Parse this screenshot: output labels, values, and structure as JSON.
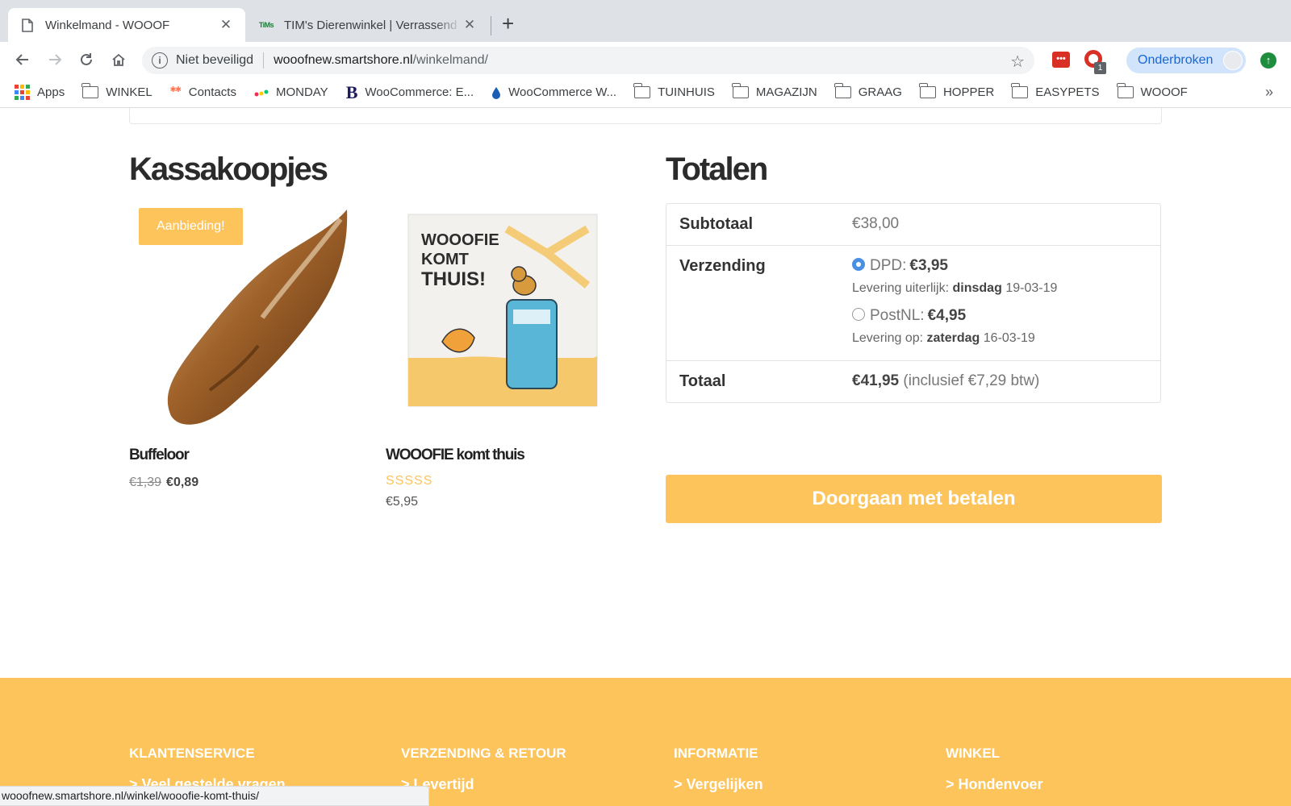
{
  "browser": {
    "tabs": [
      {
        "title": "Winkelmand - WOOOF",
        "active": true
      },
      {
        "title": "TIM's Dierenwinkel | Verrassend",
        "active": false,
        "favicon_text": "TiMs"
      }
    ],
    "omnibox": {
      "security": "Niet beveiligd",
      "host": "wooofnew.smartshore.nl",
      "path": "/winkelmand/"
    },
    "profile": "Onderbroken",
    "extension_badge": "1",
    "ext1_label": "•••",
    "bookmarks": [
      "Apps",
      "WINKEL",
      "Contacts",
      "MONDAY",
      "WooCommerce: E...",
      "WooCommerce W...",
      "TUINHUIS",
      "MAGAZIJN",
      "GRAAG",
      "HOPPER",
      "EASYPETS",
      "WOOOF"
    ],
    "status_url": "wooofnew.smartshore.nl/winkel/wooofie-komt-thuis/"
  },
  "cross_sells": {
    "heading": "Kassakoopjes",
    "products": [
      {
        "name": "Buffeloor",
        "sale_badge": "Aanbieding!",
        "old_price": "€1,39",
        "price": "€0,89"
      },
      {
        "name": "WOOOFIE komt thuis",
        "stars": "SSSSS",
        "price": "€5,95",
        "cover_text": "WOOOFIE KOMT THUIS!"
      }
    ]
  },
  "totals": {
    "heading": "Totalen",
    "subtotal_label": "Subtotaal",
    "subtotal_value": "€38,00",
    "shipping_label": "Verzending",
    "shipping_options": [
      {
        "carrier": "DPD:",
        "price": "€3,95",
        "note_prefix": "Levering uiterlijk:",
        "note_day": "dinsdag",
        "note_date": "19-03-19",
        "selected": true
      },
      {
        "carrier": "PostNL:",
        "price": "€4,95",
        "note_prefix": "Levering op:",
        "note_day": "zaterdag",
        "note_date": "16-03-19",
        "selected": false
      }
    ],
    "total_label": "Totaal",
    "total_value": "€41,95",
    "total_tax_note": "(inclusief €7,29 btw)"
  },
  "checkout_button": "Doorgaan met betalen",
  "footer": {
    "columns": [
      {
        "heading": "KLANTENSERVICE",
        "first_link": "> Veel gestelde vragen"
      },
      {
        "heading": "VERZENDING & RETOUR",
        "first_link": "> Levertijd"
      },
      {
        "heading": "INFORMATIE",
        "first_link": "> Vergelijken"
      },
      {
        "heading": "WINKEL",
        "first_link": "> Hondenvoer"
      }
    ]
  },
  "colors": {
    "accent": "#fdc45c",
    "link_blue": "#1967d2"
  }
}
